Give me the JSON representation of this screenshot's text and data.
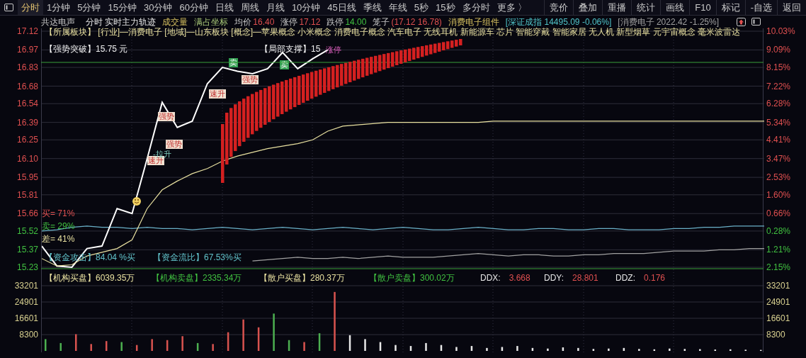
{
  "menu": {
    "tabs": [
      {
        "label": "分时",
        "selected": true
      },
      {
        "label": "1分钟",
        "selected": false
      },
      {
        "label": "5分钟",
        "selected": false
      },
      {
        "label": "15分钟",
        "selected": false
      },
      {
        "label": "30分钟",
        "selected": false
      },
      {
        "label": "60分钟",
        "selected": false
      },
      {
        "label": "日线",
        "selected": false
      },
      {
        "label": "周线",
        "selected": false
      },
      {
        "label": "月线",
        "selected": false
      },
      {
        "label": "10分钟",
        "selected": false
      },
      {
        "label": "45日线",
        "selected": false
      },
      {
        "label": "季线",
        "selected": false
      },
      {
        "label": "年线",
        "selected": false
      },
      {
        "label": "5秒",
        "selected": false
      },
      {
        "label": "15秒",
        "selected": false
      },
      {
        "label": "多分时",
        "selected": false
      },
      {
        "label": "更多 〉",
        "selected": false
      }
    ],
    "tools": [
      "竞价",
      "叠加",
      "重播",
      "统计",
      "画线",
      "F10",
      "标记",
      "-自选",
      "返回"
    ]
  },
  "info": {
    "stock": "共达电声",
    "items": [
      {
        "value": "分时 实时主力轨迹",
        "kind": "title"
      },
      {
        "value": "成交量",
        "kind": "sector"
      },
      {
        "value": "满占坐标",
        "kind": "axis"
      },
      {
        "label": "均价",
        "value": "16.40",
        "kind": "up"
      },
      {
        "label": "涨停",
        "value": "17.12",
        "kind": "up"
      },
      {
        "label": "跌停",
        "value": "14.00",
        "kind": "down"
      },
      {
        "label": "笼子",
        "value": "(17.12 16.78)",
        "kind": "up"
      },
      {
        "value": "消费电子组件",
        "kind": "sector"
      },
      {
        "value": "[深证成指 14495.09 -0.06%]",
        "kind": "index"
      },
      {
        "value": "[消费电子 2022.42 -1.25%]",
        "kind": "board"
      }
    ]
  },
  "price_chart": {
    "chart_data": {
      "type": "line",
      "ylim": [
        15.23,
        17.12
      ],
      "grid": true,
      "yticks": [
        {
          "value": 17.12,
          "label": "17.12"
        },
        {
          "value": 16.97,
          "label": "16.97"
        },
        {
          "value": 16.83,
          "label": "16.83"
        },
        {
          "value": 16.68,
          "label": "16.68"
        },
        {
          "value": 16.54,
          "label": "16.54"
        },
        {
          "value": 16.39,
          "label": "16.39"
        },
        {
          "value": 16.25,
          "label": "16.25"
        },
        {
          "value": 16.1,
          "label": "16.10"
        },
        {
          "value": 15.95,
          "label": "15.95"
        },
        {
          "value": 15.81,
          "label": "15.81"
        },
        {
          "value": 15.66,
          "label": "15.66"
        },
        {
          "value": 15.52,
          "label": "15.52"
        },
        {
          "value": 15.37,
          "label": "15.37"
        },
        {
          "value": 15.23,
          "label": "15.23"
        }
      ],
      "series": [
        {
          "color": "#6ab0c8",
          "values": [
            15.52,
            15.53,
            15.55,
            15.56,
            15.55,
            15.55,
            15.54,
            15.55,
            15.54,
            15.54,
            15.53,
            15.54,
            15.55,
            15.54,
            15.53,
            15.54,
            15.55,
            15.54,
            15.53,
            15.54,
            15.55,
            15.54,
            15.53,
            15.54,
            15.55,
            15.54,
            15.53,
            15.53,
            15.54,
            15.55,
            15.54,
            15.53,
            15.53,
            15.54,
            15.54,
            15.53,
            15.53,
            15.54,
            15.54,
            15.53,
            15.53,
            15.53,
            15.54,
            15.54,
            15.55,
            15.55,
            15.56,
            15.56,
            15.56
          ]
        },
        {
          "color": "#a0a0a0",
          "values": [
            null,
            null,
            null,
            null,
            null,
            null,
            null,
            null,
            null,
            null,
            null,
            null,
            null,
            null,
            15.28,
            15.29,
            15.3,
            15.31,
            15.3,
            15.3,
            15.31,
            15.3,
            15.31,
            15.32,
            15.31,
            15.31,
            15.31,
            15.32,
            15.33,
            15.34,
            15.33,
            15.32,
            15.33,
            15.33,
            15.32,
            15.32,
            15.33,
            15.33,
            15.34,
            15.34,
            15.34,
            15.35,
            15.36,
            15.36,
            15.36,
            15.37,
            15.37,
            15.38,
            15.38
          ]
        },
        {
          "color": "#ffffff",
          "values": [
            15.4,
            15.24,
            15.23,
            15.38,
            15.4,
            15.7,
            15.66,
            16.1,
            16.55,
            16.35,
            16.4,
            16.7,
            16.83,
            16.8,
            16.78,
            16.82,
            16.95,
            16.82,
            16.9,
            16.97,
            null,
            null,
            null,
            null,
            null,
            null,
            null,
            null,
            null,
            null,
            null,
            null,
            null,
            null,
            null,
            null,
            null,
            null,
            null,
            null,
            null,
            null,
            null,
            null,
            null,
            null,
            null,
            null,
            null
          ]
        },
        {
          "color": "#e8e0a0",
          "values": [
            15.3,
            15.24,
            15.25,
            15.32,
            15.35,
            15.38,
            15.45,
            15.7,
            15.85,
            15.92,
            15.98,
            16.02,
            16.08,
            16.12,
            16.15,
            16.18,
            16.2,
            16.22,
            16.25,
            16.32,
            16.36,
            16.37,
            16.38,
            16.39,
            16.39,
            16.39,
            16.39,
            16.39,
            16.39,
            16.39,
            16.4,
            16.4,
            16.4,
            16.4,
            16.4,
            16.4,
            16.4,
            16.4,
            16.4,
            16.4,
            16.4,
            16.4,
            16.4,
            16.4,
            16.4,
            16.4,
            16.4,
            16.4,
            16.4
          ]
        }
      ]
    },
    "right_axis": [
      {
        "label": "10.03%",
        "down": false
      },
      {
        "label": "9.09%",
        "down": false
      },
      {
        "label": "8.15%",
        "down": false
      },
      {
        "label": "7.22%",
        "down": false
      },
      {
        "label": "6.28%",
        "down": false
      },
      {
        "label": "5.34%",
        "down": false
      },
      {
        "label": "4.41%",
        "down": false
      },
      {
        "label": "3.47%",
        "down": false
      },
      {
        "label": "2.53%",
        "down": false
      },
      {
        "label": "1.60%",
        "down": false
      },
      {
        "label": "0.66%",
        "down": false
      },
      {
        "label": "0.28%",
        "down": true
      },
      {
        "label": "1.21%",
        "down": true
      },
      {
        "label": "2.15%",
        "down": true
      }
    ],
    "sector_line": "【所属板块】 [行业]—消费电子 [地域]—山东板块 [概念]—苹果概念 小米概念 消费电子概念 汽车电子 无线耳机 新能源车 芯片 智能穿戴 智能家居 无人机 新型烟草 元宇宙概念 毫米波雷达",
    "breakout": "【强势突破】15.75 元",
    "support": "【局部支撑】15",
    "markers": [
      {
        "text": "速升",
        "kind": "signal"
      },
      {
        "text": "强势",
        "kind": "signal"
      },
      {
        "text": "-拉升",
        "kind": "rise"
      },
      {
        "text": "强势",
        "kind": "signal"
      },
      {
        "text": "速升",
        "kind": "signal"
      },
      {
        "text": "强势",
        "kind": "signal"
      },
      {
        "text": "卖",
        "kind": "sell"
      },
      {
        "text": "卖",
        "kind": "sell"
      },
      {
        "text": "涨停",
        "kind": "limit"
      }
    ],
    "ratios": [
      {
        "label": "买= 71%",
        "kind": "buy"
      },
      {
        "label": "卖= 29%",
        "kind": "sell"
      },
      {
        "label": "差= 41%",
        "kind": "diff"
      }
    ],
    "flows": [
      "【资金攻击】84.04 %买",
      "【资金流比】67.53%买"
    ],
    "orders": [
      {
        "text": "【机构买盘】6039.35万",
        "kind": "buy"
      },
      {
        "text": "【机构卖盘】2335.34万",
        "kind": "sell"
      },
      {
        "text": "【散户买盘】280.37万",
        "kind": "buy"
      },
      {
        "text": "【散户卖盘】300.02万",
        "kind": "sell"
      }
    ],
    "dd": [
      {
        "label": "DDX:",
        "value": "3.668"
      },
      {
        "label": "DDY:",
        "value": "28.801"
      },
      {
        "label": "DDZ:",
        "value": "0.176"
      }
    ]
  },
  "volume_chart": {
    "chart_data": {
      "type": "bar",
      "grid": true,
      "ylim": [
        0,
        33201
      ],
      "yticks": [
        {
          "value": 33201,
          "label": "33201"
        },
        {
          "value": 24901,
          "label": "24901"
        },
        {
          "value": 16601,
          "label": "16601"
        },
        {
          "value": 8300,
          "label": "8300"
        }
      ],
      "series": [
        {
          "color": "#d9534f",
          "values": [
            null,
            null,
            8500,
            3500,
            5000,
            null,
            3000,
            6000,
            5500,
            7500,
            null,
            3500,
            9500,
            16000,
            12000,
            null,
            null,
            4500,
            null,
            30000,
            null,
            null,
            null,
            null,
            null,
            null,
            null,
            null,
            null,
            null,
            null,
            null,
            null,
            null,
            null,
            null,
            null,
            null,
            null,
            null,
            null,
            null,
            null,
            null,
            null,
            null,
            null,
            null
          ]
        },
        {
          "color": "#4caf50",
          "values": [
            6000,
            4000,
            null,
            null,
            null,
            4500,
            null,
            null,
            null,
            null,
            4000,
            null,
            null,
            null,
            null,
            19000,
            5500,
            null,
            9000,
            null,
            null,
            null,
            null,
            null,
            null,
            null,
            null,
            null,
            null,
            null,
            null,
            null,
            null,
            null,
            null,
            null,
            null,
            null,
            null,
            null,
            null,
            null,
            null,
            null,
            null,
            null,
            null,
            null
          ]
        },
        {
          "color": "#e8e8e8",
          "values": [
            null,
            null,
            null,
            null,
            null,
            null,
            null,
            null,
            null,
            null,
            null,
            null,
            null,
            null,
            null,
            null,
            null,
            null,
            null,
            null,
            8000,
            6000,
            4500,
            3000,
            2500,
            4000,
            3000,
            2000,
            2500,
            1500,
            2000,
            2500,
            1500,
            1200,
            1800,
            1500,
            1000,
            1200,
            1500,
            1000,
            800,
            1200,
            1000,
            900,
            700,
            800,
            600,
            500
          ]
        }
      ]
    }
  }
}
